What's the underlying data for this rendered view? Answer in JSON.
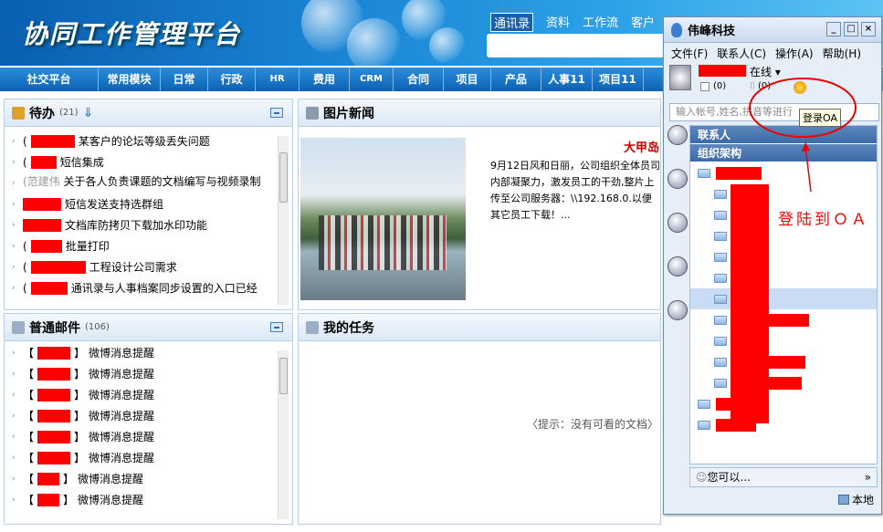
{
  "header": {
    "logo_text": "协同工作管理平台",
    "top_links": [
      {
        "label": "通讯录",
        "active": true
      },
      {
        "label": "资料"
      },
      {
        "label": "工作流"
      },
      {
        "label": "客户"
      }
    ]
  },
  "nav": [
    "社交平台",
    "常用模块",
    "日常",
    "行政",
    "HR",
    "费用",
    "CRM",
    "合同",
    "项目",
    "产品",
    "人事11",
    "项目11"
  ],
  "todo": {
    "title": "待办",
    "count": "(21)",
    "items": [
      {
        "prefix": "(",
        "text": "某客户的论坛等级丢失问题"
      },
      {
        "prefix": "(",
        "text": "短信集成"
      },
      {
        "prefix": "(范建伟",
        "text": "关于各人负责课题的文档编写与视频录制"
      },
      {
        "prefix": "",
        "text": "短信发送支持选群组"
      },
      {
        "prefix": "",
        "text": "文档库防拷贝下载加水印功能"
      },
      {
        "prefix": "(",
        "text": "批量打印"
      },
      {
        "prefix": "(",
        "text": "工程设计公司需求"
      },
      {
        "prefix": "(",
        "text": "通讯录与人事档案同步设置的入口已经"
      }
    ]
  },
  "news": {
    "title": "图片新闻",
    "headline": "大甲岛",
    "body": "9月12日风和日丽，公司组织全体员司内部凝聚力，激发员工的干劲,整片上传至公司服务器：\\\\192.168.0.以便其它员工下载！..."
  },
  "mail": {
    "title": "普通邮件",
    "count": "(106)",
    "items": [
      "微博消息提醒",
      "微博消息提醒",
      "微博消息提醒",
      "微博消息提醒",
      "微博消息提醒",
      "微博消息提醒",
      "微博消息提醒",
      "微博消息提醒"
    ]
  },
  "tasks": {
    "title": "我的任务",
    "empty": "〈提示：没有可看的文档〉"
  },
  "im": {
    "title": "伟峰科技",
    "menu": [
      "文件(F)",
      "联系人(C)",
      "操作(A)",
      "帮助(H)"
    ],
    "status": "在线",
    "mail_count": "(0)",
    "file_count": "(0)",
    "search_placeholder": "输入帐号,姓名,拼音等进行",
    "tooltip": "登录OA",
    "groups": [
      "联系人",
      "组织架构"
    ],
    "bottom_text": "您可以...",
    "footer": "本地"
  },
  "annotation": {
    "text": "登陆到ＯＡ",
    "color": "#ff0000"
  }
}
